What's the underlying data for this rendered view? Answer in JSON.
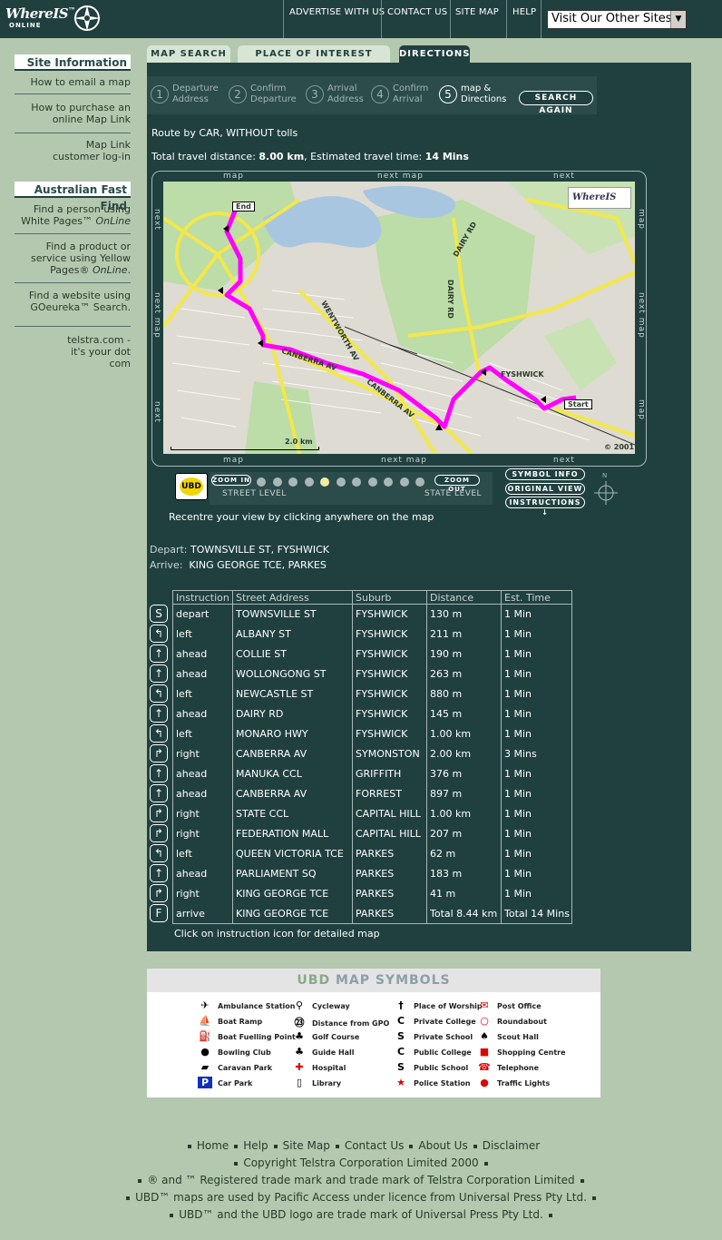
{
  "header": {
    "logo_text": "WhereIS",
    "logo_tm": "™",
    "logo_sub": "ONLINE",
    "nav": [
      "ADVERTISE WITH US",
      "CONTACT US",
      "SITE MAP",
      "HELP"
    ],
    "sites_select": "Visit Our Other Sites"
  },
  "sidebar": {
    "site_info_title": "Site Information",
    "site_info": [
      "How to email a map",
      "How to purchase an online Map Link",
      "Map Link customer log-in"
    ],
    "fast_find_title": "Australian Fast Find",
    "fast_find": [
      {
        "pre": "Find a person using White Pages™ ",
        "em": "OnLine"
      },
      {
        "pre": "Find a product or service using Yellow Pages® ",
        "em": "OnLine",
        "post": "."
      },
      {
        "pre": "Find a website using GOeureka™ Search.",
        "em": ""
      }
    ],
    "telstra": "telstra.com - it's your dot com"
  },
  "tabs": [
    "MAP SEARCH",
    "PLACE OF INTEREST SEARCH",
    "DIRECTIONS"
  ],
  "steps": [
    {
      "n": "1",
      "l1": "Departure",
      "l2": "Address"
    },
    {
      "n": "2",
      "l1": "Confirm",
      "l2": "Departure"
    },
    {
      "n": "3",
      "l1": "Arrival",
      "l2": "Address"
    },
    {
      "n": "4",
      "l1": "Confirm",
      "l2": "Arrival"
    },
    {
      "n": "5",
      "l1": "map &",
      "l2": "Directions"
    }
  ],
  "search_again": "SEARCH AGAIN",
  "route": {
    "mode": "Route by CAR, WITHOUT tolls",
    "dist_label": "Total travel distance: ",
    "dist_value": "8.00 km",
    "time_label": ", Estimated travel time: ",
    "time_value": "14 Mins"
  },
  "map_nav": {
    "top": [
      "map",
      "next map",
      "next"
    ],
    "bottom": [
      "map",
      "next map",
      "next"
    ],
    "left": [
      "next",
      "next map",
      "next"
    ],
    "right": [
      "map",
      "next map",
      "map"
    ]
  },
  "map": {
    "labels": {
      "end": "End",
      "start": "Start",
      "fyshwick": "FYSHWICK",
      "dairy1": "DAIRY RD",
      "dairy2": "DAIRY RD",
      "wentworth": "WENTWORTH AV",
      "canberra1": "CANBERRA AV",
      "canberra2": "CANBERRA AV",
      "scale": "2.0 km",
      "copyright": "© 2001",
      "watermark": "WhereIS"
    }
  },
  "zoom": {
    "in": "ZOOM IN",
    "out": "ZOOM OUT",
    "street": "STREET LEVEL",
    "state": "STATE LEVEL",
    "levels": 11,
    "selected": 4,
    "ubd": "UBD"
  },
  "map_buttons": [
    "SYMBOL INFO",
    "ORIGINAL VIEW",
    "INSTRUCTIONS"
  ],
  "recentre": "Recentre your view by clicking anywhere on the map",
  "depart_label": "Depart:",
  "depart_value": "TOWNSVILLE ST, FYSHWICK",
  "arrive_label": "Arrive:",
  "arrive_value": "KING GEORGE TCE, PARKES",
  "table": {
    "headers": [
      "Instruction",
      "Street Address",
      "Suburb",
      "Distance",
      "Est. Time"
    ],
    "rows": [
      {
        "icon": "S",
        "instr": "depart",
        "street": "TOWNSVILLE ST",
        "suburb": "FYSHWICK",
        "dist": "130 m",
        "time": "1 Min"
      },
      {
        "icon": "left",
        "instr": "left",
        "street": "ALBANY ST",
        "suburb": "FYSHWICK",
        "dist": "211 m",
        "time": "1 Min"
      },
      {
        "icon": "ahead",
        "instr": "ahead",
        "street": "COLLIE ST",
        "suburb": "FYSHWICK",
        "dist": "190 m",
        "time": "1 Min"
      },
      {
        "icon": "ahead",
        "instr": "ahead",
        "street": "WOLLONGONG ST",
        "suburb": "FYSHWICK",
        "dist": "263 m",
        "time": "1 Min"
      },
      {
        "icon": "left",
        "instr": "left",
        "street": "NEWCASTLE ST",
        "suburb": "FYSHWICK",
        "dist": "880 m",
        "time": "1 Min"
      },
      {
        "icon": "ahead",
        "instr": "ahead",
        "street": "DAIRY RD",
        "suburb": "FYSHWICK",
        "dist": "145 m",
        "time": "1 Min"
      },
      {
        "icon": "left",
        "instr": "left",
        "street": "MONARO HWY",
        "suburb": "FYSHWICK",
        "dist": "1.00 km",
        "time": "1 Min"
      },
      {
        "icon": "right",
        "instr": "right",
        "street": "CANBERRA AV",
        "suburb": "SYMONSTON",
        "dist": "2.00 km",
        "time": "3 Mins"
      },
      {
        "icon": "ahead",
        "instr": "ahead",
        "street": "MANUKA CCL",
        "suburb": "GRIFFITH",
        "dist": "376 m",
        "time": "1 Min"
      },
      {
        "icon": "ahead",
        "instr": "ahead",
        "street": "CANBERRA AV",
        "suburb": "FORREST",
        "dist": "897 m",
        "time": "1 Min"
      },
      {
        "icon": "right",
        "instr": "right",
        "street": "STATE CCL",
        "suburb": "CAPITAL HILL",
        "dist": "1.00 km",
        "time": "1 Min"
      },
      {
        "icon": "right",
        "instr": "right",
        "street": "FEDERATION MALL",
        "suburb": "CAPITAL HILL",
        "dist": "207 m",
        "time": "1 Min"
      },
      {
        "icon": "left",
        "instr": "left",
        "street": "QUEEN VICTORIA TCE",
        "suburb": "PARKES",
        "dist": "62 m",
        "time": "1 Min"
      },
      {
        "icon": "ahead",
        "instr": "ahead",
        "street": "PARLIAMENT SQ",
        "suburb": "PARKES",
        "dist": "183 m",
        "time": "1 Min"
      },
      {
        "icon": "right",
        "instr": "right",
        "street": "KING GEORGE TCE",
        "suburb": "PARKES",
        "dist": "41 m",
        "time": "1 Min"
      },
      {
        "icon": "F",
        "instr": "arrive",
        "street": "KING GEORGE TCE",
        "suburb": "PARKES",
        "dist": "Total 8.44 km",
        "time": "Total 14 Mins"
      }
    ]
  },
  "click_note": "Click on instruction icon for detailed map",
  "symbols": {
    "title_a": "UBD",
    "title_b": " MAP SYMBOLS",
    "columns": [
      [
        {
          "g": "✈",
          "t": "Ambulance Station"
        },
        {
          "g": "⛵",
          "t": "Boat Ramp"
        },
        {
          "g": "⛽",
          "t": "Boat Fuelling Point"
        },
        {
          "g": "●",
          "t": "Bowling Club"
        },
        {
          "g": "▰",
          "t": "Caravan Park"
        },
        {
          "g": "P",
          "t": "Car Park"
        }
      ],
      [
        {
          "g": "⚲",
          "t": "Cycleway"
        },
        {
          "g": "㉓",
          "t": "Distance from GPO"
        },
        {
          "g": "♣",
          "t": "Golf Course"
        },
        {
          "g": "♣",
          "t": "Guide Hall"
        },
        {
          "g": "✚",
          "t": "Hospital"
        },
        {
          "g": "▯",
          "t": "Library"
        }
      ],
      [
        {
          "g": "†",
          "t": "Place of Worship"
        },
        {
          "g": "C",
          "t": "Private College"
        },
        {
          "g": "S",
          "t": "Private School"
        },
        {
          "g": "C",
          "t": "Public College"
        },
        {
          "g": "S",
          "t": "Public School"
        },
        {
          "g": "★",
          "t": "Police Station"
        }
      ],
      [
        {
          "g": "✉",
          "t": "Post Office"
        },
        {
          "g": "○",
          "t": "Roundabout"
        },
        {
          "g": "♠",
          "t": "Scout Hall"
        },
        {
          "g": "■",
          "t": "Shopping Centre"
        },
        {
          "g": "☎",
          "t": "Telephone"
        },
        {
          "g": "●",
          "t": "Traffic Lights"
        }
      ]
    ]
  },
  "footer": {
    "links": [
      "Home",
      "Help",
      "Site Map",
      "Contact Us",
      "About Us",
      "Disclaimer"
    ],
    "lines": [
      "Copyright Telstra Corporation Limited 2000",
      "® and ™ Registered trade mark and trade mark of Telstra Corporation Limited",
      "UBD™ maps are used by Pacific Access under licence from Universal Press Pty Ltd.",
      "UBD™ and the UBD logo are trade mark of Universal Press Pty Ltd."
    ]
  },
  "colors": {
    "route": "#ff00ff",
    "panel": "#20403f",
    "page": "#b4c8b0",
    "major_road": "#f2e84a",
    "water": "#a9c6e0",
    "park": "#bcdca8"
  }
}
